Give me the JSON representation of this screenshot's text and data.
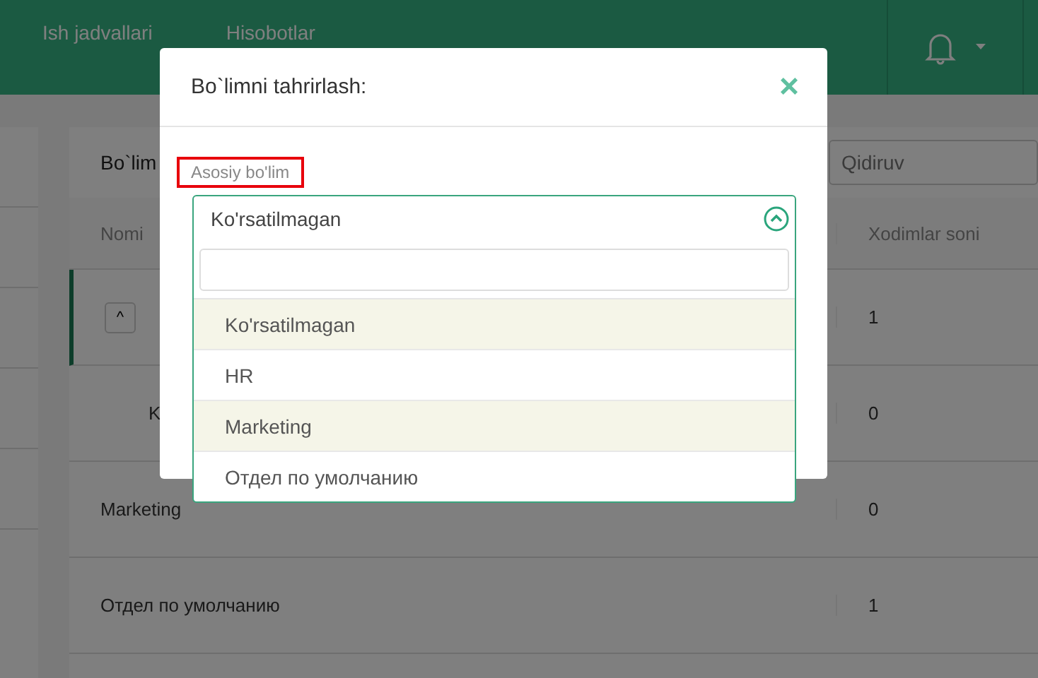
{
  "header": {
    "nav": [
      "Ish jadvallari",
      "Hisobotlar"
    ]
  },
  "panel": {
    "title": "Bo`lim",
    "search": {
      "placeholder": "Qidiruv"
    },
    "columns": [
      "Nomi",
      "Xodimlar soni"
    ],
    "rows": [
      {
        "count": "1",
        "selected": true,
        "expander": "^",
        "indent": false
      },
      {
        "name": "K",
        "count": "0",
        "selected": false,
        "indent": true
      },
      {
        "name": "Marketing",
        "count": "0",
        "selected": false,
        "indent": false
      },
      {
        "name": "Отдел по умолчанию",
        "count": "1",
        "selected": false,
        "indent": false
      }
    ]
  },
  "modal": {
    "title": "Bo`limni tahrirlash:",
    "close": "×",
    "field_label": {
      "text": "Asosiy bo'lim",
      "highlighted": true
    },
    "select": {
      "value": "Ko'rsatilmagan",
      "expanded": true,
      "options": [
        {
          "label": "Ko'rsatilmagan",
          "highlighted": true
        },
        {
          "label": "HR",
          "highlighted": false
        },
        {
          "label": "Marketing",
          "highlighted": true
        },
        {
          "label": "Отдел по умолчанию",
          "highlighted": false
        }
      ]
    }
  }
}
